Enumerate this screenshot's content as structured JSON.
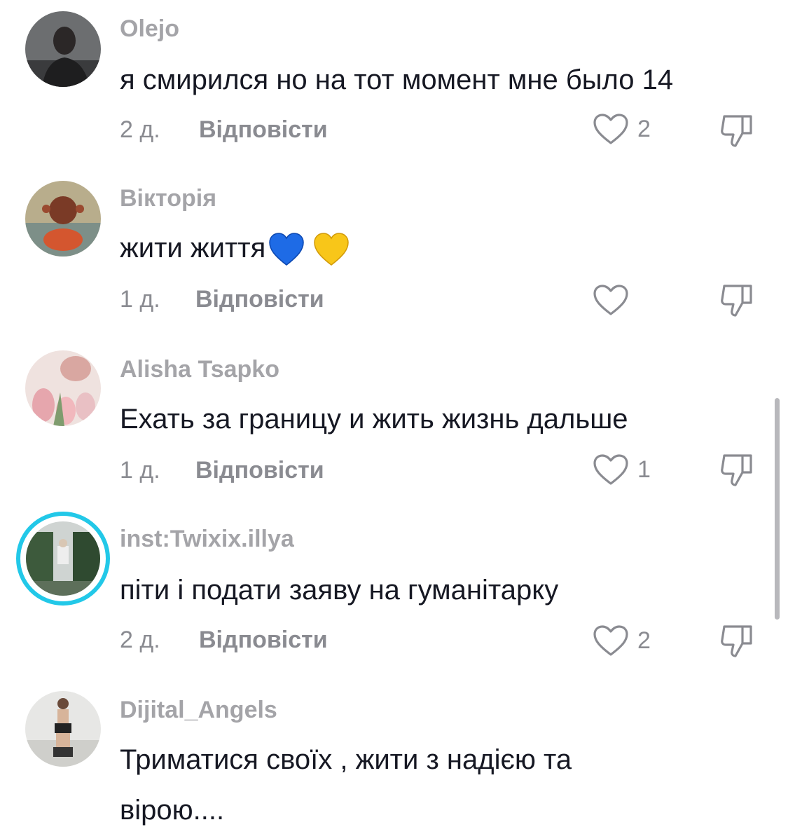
{
  "comments": [
    {
      "username": "Olejo",
      "text": "я смирился но на тот момент мне было 14",
      "age": "2 д.",
      "reply_label": "Відповісти",
      "likes": "2",
      "avatar_icon": "user-avatar-dark"
    },
    {
      "username": "Вікторія",
      "text": "жити життя",
      "emojis": [
        "blue-heart-icon",
        "yellow-heart-icon"
      ],
      "age": "1 д.",
      "reply_label": "Відповісти",
      "likes": "",
      "avatar_icon": "user-avatar-art"
    },
    {
      "username": "Alisha Tsapko",
      "text": "Ехать за границу и жить жизнь дальше",
      "age": "1 д.",
      "reply_label": "Відповісти",
      "likes": "1",
      "avatar_icon": "user-avatar-flowers"
    },
    {
      "username": "inst:Twixix.illya",
      "text": "піти і подати заяву на гуманітарку",
      "age": "2 д.",
      "reply_label": "Відповісти",
      "likes": "2",
      "avatar_icon": "user-avatar-story"
    },
    {
      "username": "Dijital_Angels",
      "text_lines": [
        "Триматися своїх , жити з надією та",
        "вірою...."
      ],
      "avatar_icon": "user-avatar-photo"
    }
  ],
  "colors": {
    "username": "#a4a4a8",
    "text": "#161823",
    "meta": "#8a8b91",
    "story_ring": "#22c8e8"
  }
}
